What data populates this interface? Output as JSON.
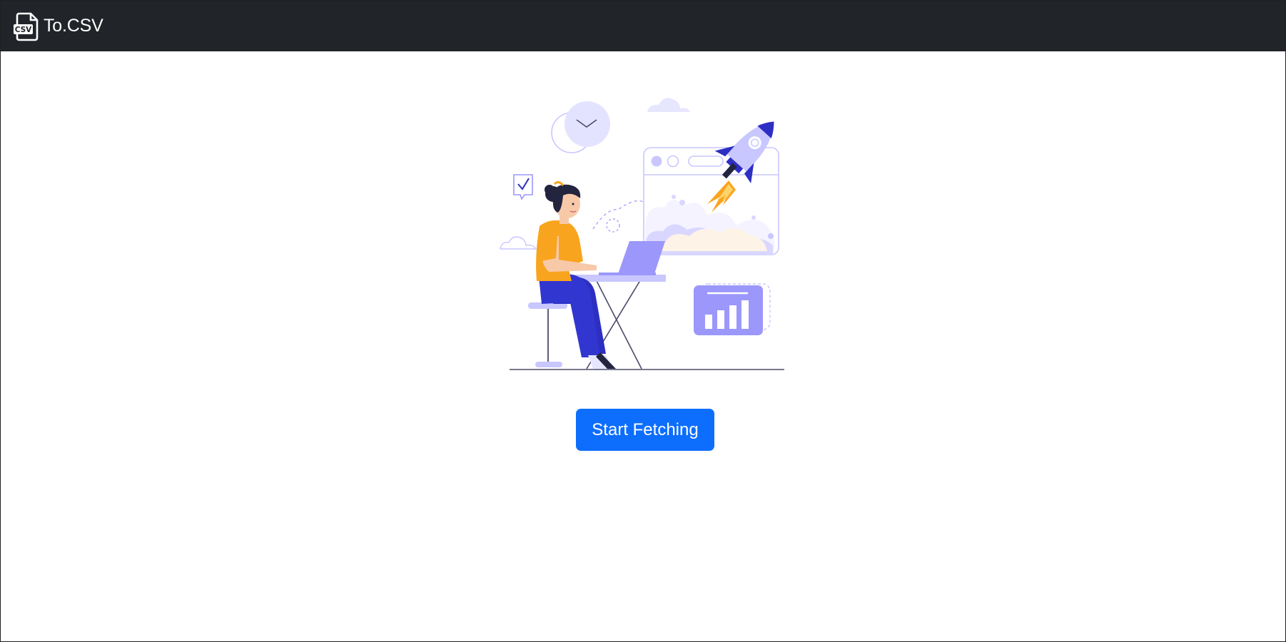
{
  "navbar": {
    "brand_label": "To.CSV",
    "brand_icon": "csv-file-icon",
    "background": "#212529"
  },
  "main": {
    "illustration": "woman-at-laptop-rocket-launch-illustration",
    "start_button_label": "Start Fetching",
    "start_button_color": "#0d6efd"
  },
  "palette": {
    "accent_purple": "#9b97fb",
    "light_purple": "#e7e6ff",
    "dark_blue": "#2d2fc2",
    "orange": "#f9a41e"
  }
}
